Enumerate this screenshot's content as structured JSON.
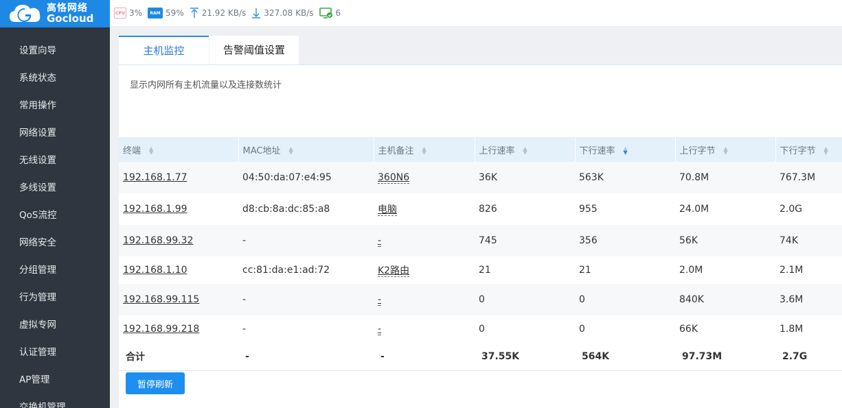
{
  "brand": {
    "name_cn": "高恪网络",
    "name_en": "Gocloud"
  },
  "sidebar": {
    "items": [
      {
        "label": "设置向导"
      },
      {
        "label": "系统状态"
      },
      {
        "label": "常用操作"
      },
      {
        "label": "网络设置"
      },
      {
        "label": "无线设置"
      },
      {
        "label": "多线设置"
      },
      {
        "label": "QoS流控"
      },
      {
        "label": "网络安全"
      },
      {
        "label": "分组管理"
      },
      {
        "label": "行为管理"
      },
      {
        "label": "虚拟专网"
      },
      {
        "label": "认证管理"
      },
      {
        "label": "AP管理"
      },
      {
        "label": "交换机管理"
      }
    ]
  },
  "status": {
    "cpu_badge": "CPU",
    "cpu": "3%",
    "ram_badge": "RAM",
    "ram": "59%",
    "upload": "21.92 KB/s",
    "download": "327.08 KB/s",
    "online": "6"
  },
  "tabs": [
    {
      "label": "主机监控",
      "active": true
    },
    {
      "label": "告警阈值设置",
      "active": false
    }
  ],
  "description": "显示内网所有主机流量以及连接数统计",
  "table": {
    "columns": [
      "终端",
      "MAC地址",
      "主机备注",
      "上行速率",
      "下行速率",
      "上行字节",
      "下行字节"
    ],
    "sorted_column": "下行速率",
    "rows": [
      {
        "ip": "192.168.1.77",
        "mac": "04:50:da:07:e4:95",
        "note": "360N6",
        "up_rate": "36K",
        "down_rate": "563K",
        "up_bytes": "70.8M",
        "down_bytes": "767.3M"
      },
      {
        "ip": "192.168.1.99",
        "mac": "d8:cb:8a:dc:85:a8",
        "note": "电脑",
        "up_rate": "826",
        "down_rate": "955",
        "up_bytes": "24.0M",
        "down_bytes": "2.0G"
      },
      {
        "ip": "192.168.99.32",
        "mac": "-",
        "note": "-",
        "up_rate": "745",
        "down_rate": "356",
        "up_bytes": "56K",
        "down_bytes": "74K"
      },
      {
        "ip": "192.168.1.10",
        "mac": "cc:81:da:e1:ad:72",
        "note": "K2路由",
        "up_rate": "21",
        "down_rate": "21",
        "up_bytes": "2.0M",
        "down_bytes": "2.1M"
      },
      {
        "ip": "192.168.99.115",
        "mac": "-",
        "note": "-",
        "up_rate": "0",
        "down_rate": "0",
        "up_bytes": "840K",
        "down_bytes": "3.6M"
      },
      {
        "ip": "192.168.99.218",
        "mac": "-",
        "note": "-",
        "up_rate": "0",
        "down_rate": "0",
        "up_bytes": "66K",
        "down_bytes": "1.8M"
      }
    ],
    "total": {
      "label": "合计",
      "mac": "-",
      "note": "-",
      "up_rate": "37.55K",
      "down_rate": "564K",
      "up_bytes": "97.73M",
      "down_bytes": "2.7G"
    }
  },
  "pause_button": "暂停刷新",
  "colors": {
    "primary": "#1e88e5",
    "sidebar_bg": "#2f363f",
    "header_bg": "#e4f0fa"
  }
}
